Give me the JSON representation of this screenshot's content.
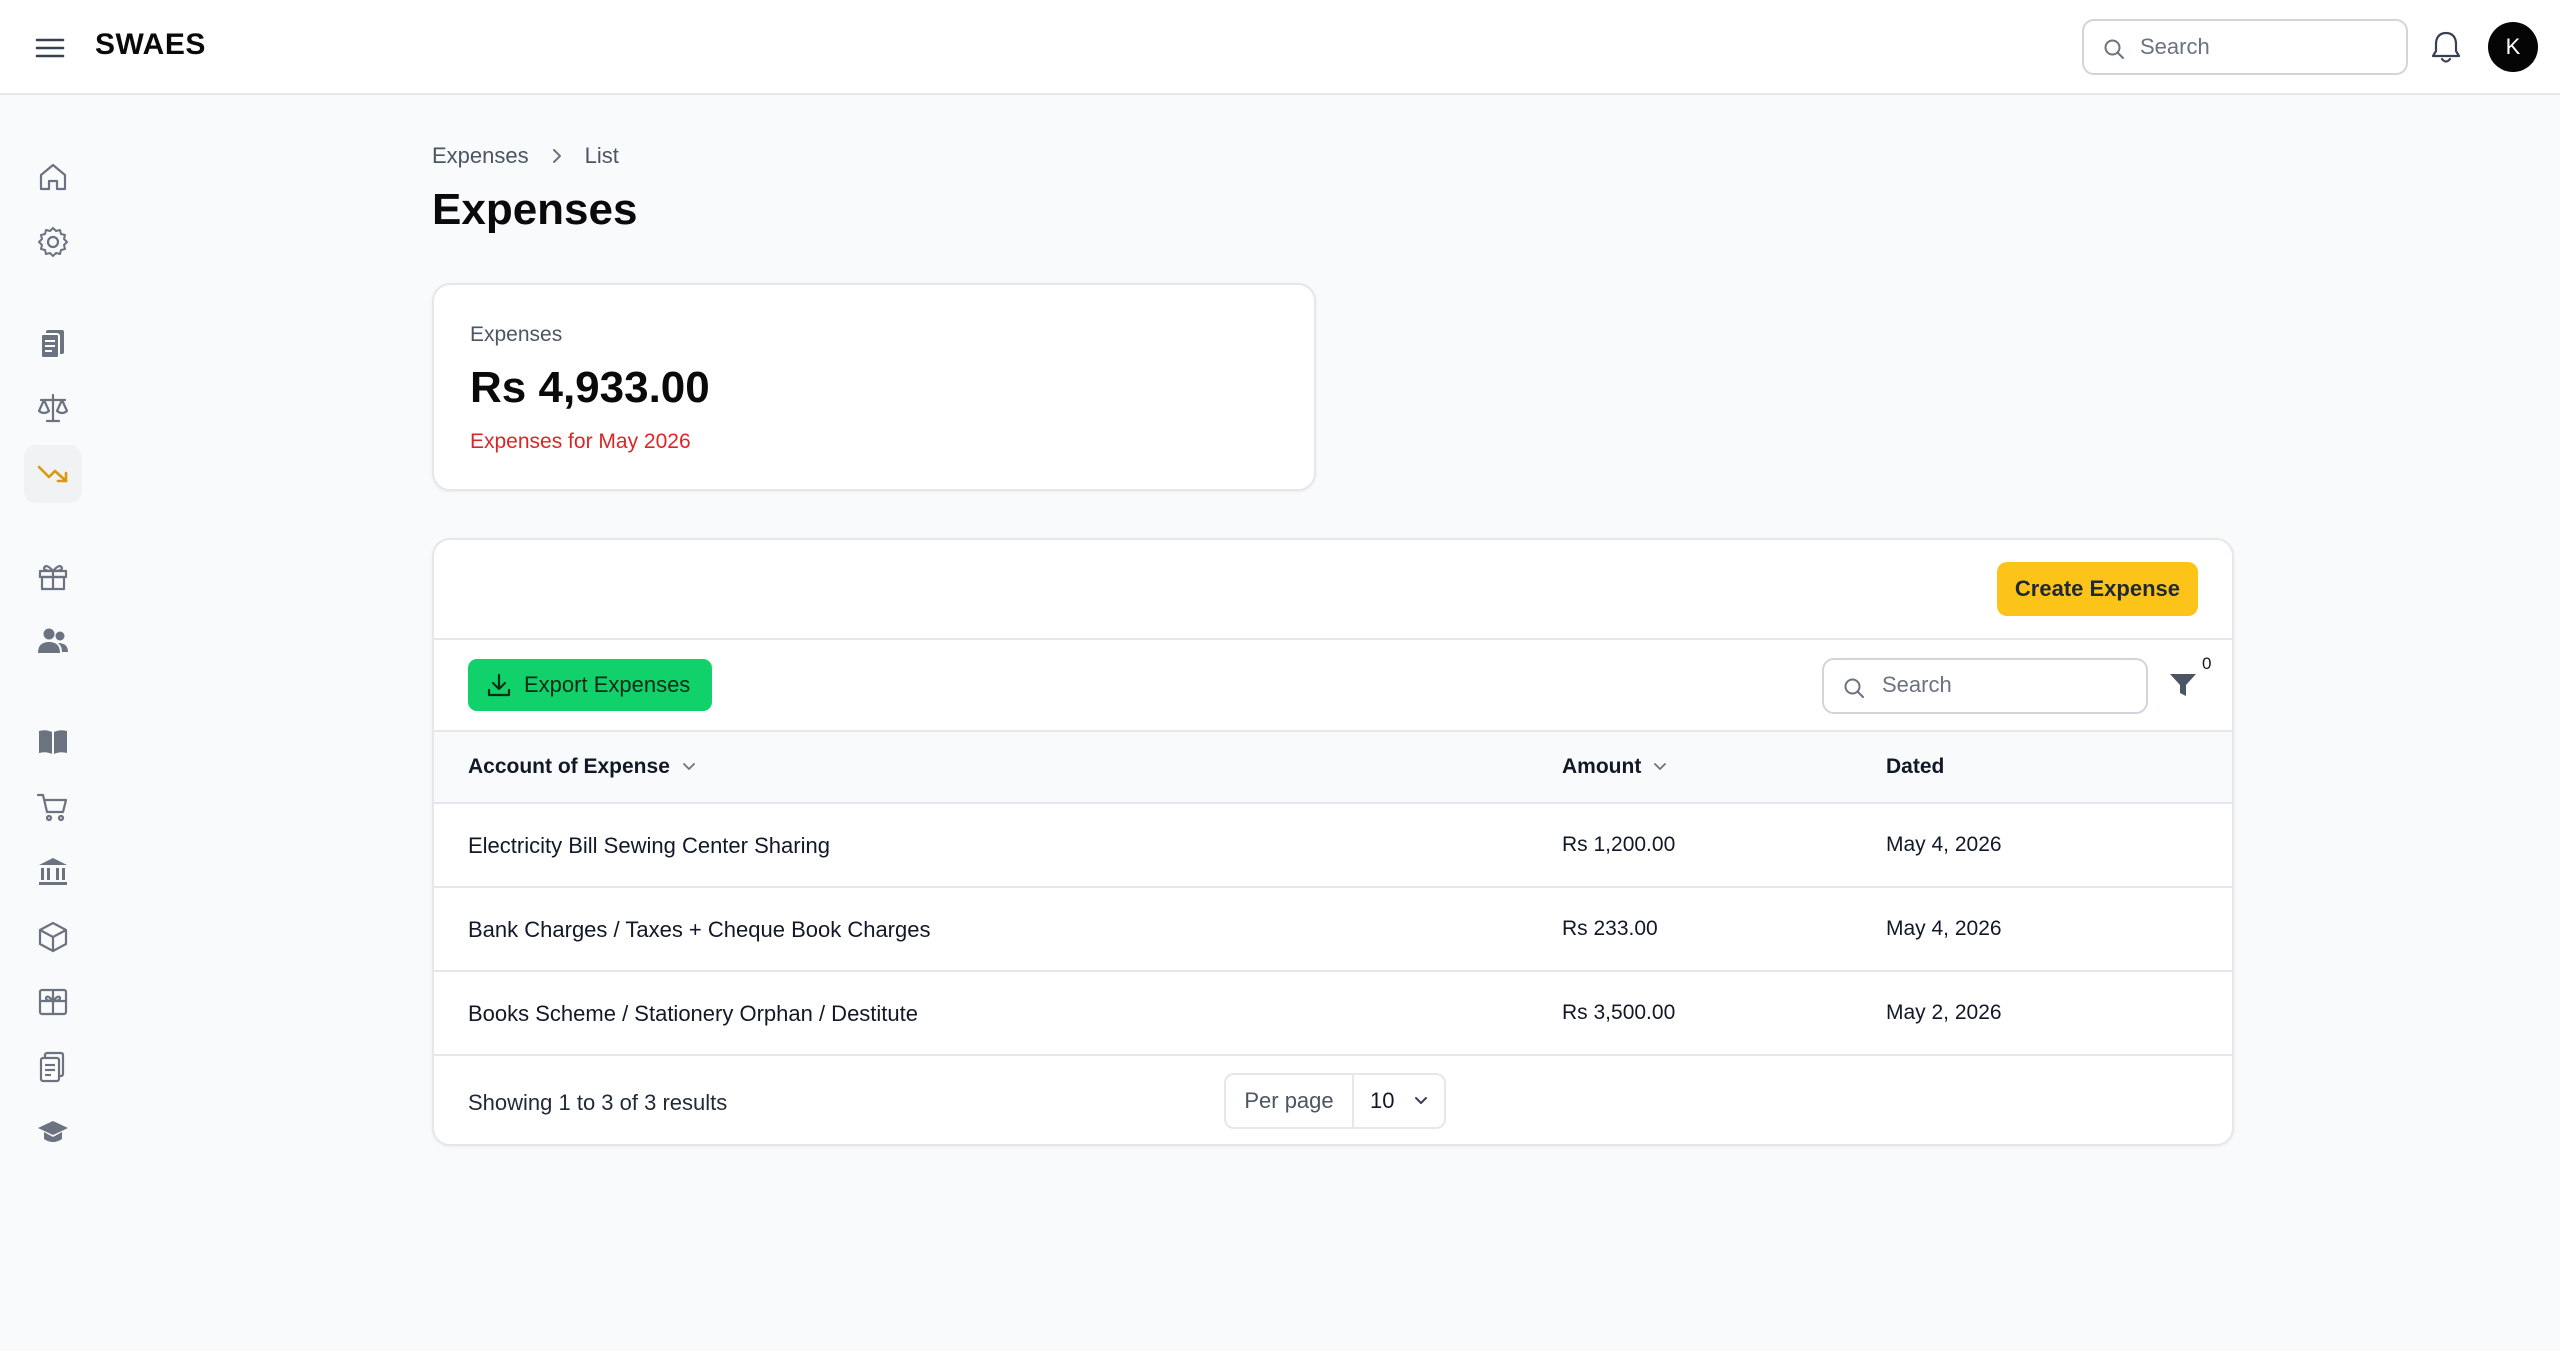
{
  "app": {
    "brand": "SWAES",
    "search_placeholder": "Search",
    "avatar_initial": "K"
  },
  "sidebar": {
    "items": [
      {
        "icon": "home-icon"
      },
      {
        "icon": "gear-icon"
      },
      {
        "icon": "documents-icon"
      },
      {
        "icon": "scale-icon"
      },
      {
        "icon": "trending-down-icon",
        "active": true,
        "accent": "#d99a0b"
      },
      {
        "icon": "gift-icon"
      },
      {
        "icon": "users-icon"
      },
      {
        "icon": "book-icon"
      },
      {
        "icon": "cart-icon"
      },
      {
        "icon": "bank-icon"
      },
      {
        "icon": "cube-icon"
      },
      {
        "icon": "gift-box-icon"
      },
      {
        "icon": "clipboard-icon"
      },
      {
        "icon": "graduation-cap-icon"
      }
    ]
  },
  "breadcrumb": {
    "items": [
      "Expenses",
      "List"
    ]
  },
  "page": {
    "title": "Expenses"
  },
  "stat": {
    "label": "Expenses",
    "value": "Rs 4,933.00",
    "description": "Expenses for May 2026",
    "description_color": "#dc2626"
  },
  "table": {
    "create_label": "Create Expense",
    "export_label": "Export Expenses",
    "search_placeholder": "Search",
    "filter_count": "0",
    "columns": [
      "Account of Expense",
      "Amount",
      "Dated"
    ],
    "rows": [
      {
        "account": "Electricity Bill Sewing Center Sharing",
        "amount": "Rs 1,200.00",
        "dated": "May 4, 2026"
      },
      {
        "account": "Bank Charges / Taxes + Cheque Book Charges",
        "amount": "Rs 233.00",
        "dated": "May 4, 2026"
      },
      {
        "account": "Books Scheme / Stationery Orphan / Destitute",
        "amount": "Rs 3,500.00",
        "dated": "May 2, 2026"
      }
    ],
    "showing": "Showing 1 to 3 of 3 results",
    "per_page_label": "Per page",
    "per_page_value": "10"
  },
  "colors": {
    "create_button": "#fcc419",
    "export_button": "#10d16a",
    "accent": "#d99a0b"
  }
}
